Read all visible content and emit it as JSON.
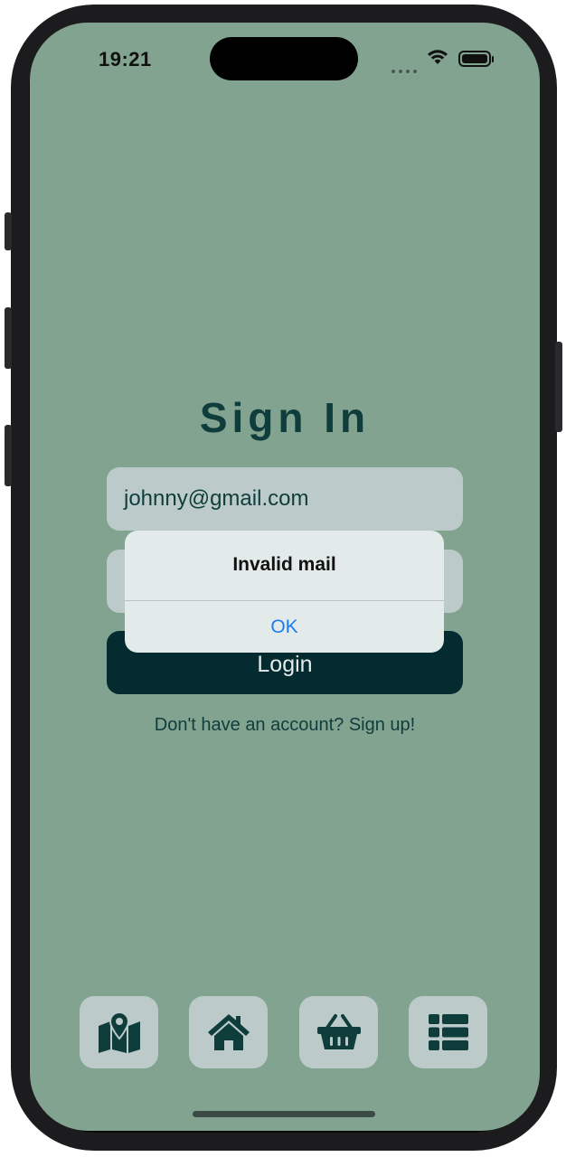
{
  "status_bar": {
    "time": "19:21"
  },
  "signin": {
    "title": "Sign In",
    "email_value": "johnny@gmail.com",
    "login_label": "Login",
    "signup_text": "Don't have an account? Sign up!"
  },
  "alert": {
    "title": "Invalid mail",
    "ok_label": "OK"
  },
  "bottom_nav": {
    "items": [
      {
        "icon": "map-pin-icon"
      },
      {
        "icon": "home-icon"
      },
      {
        "icon": "basket-icon"
      },
      {
        "icon": "list-icon"
      }
    ]
  },
  "colors": {
    "background": "#82a390",
    "primary_dark": "#042b2f",
    "field": "#bccbca",
    "alert_action": "#1e7cf2"
  }
}
